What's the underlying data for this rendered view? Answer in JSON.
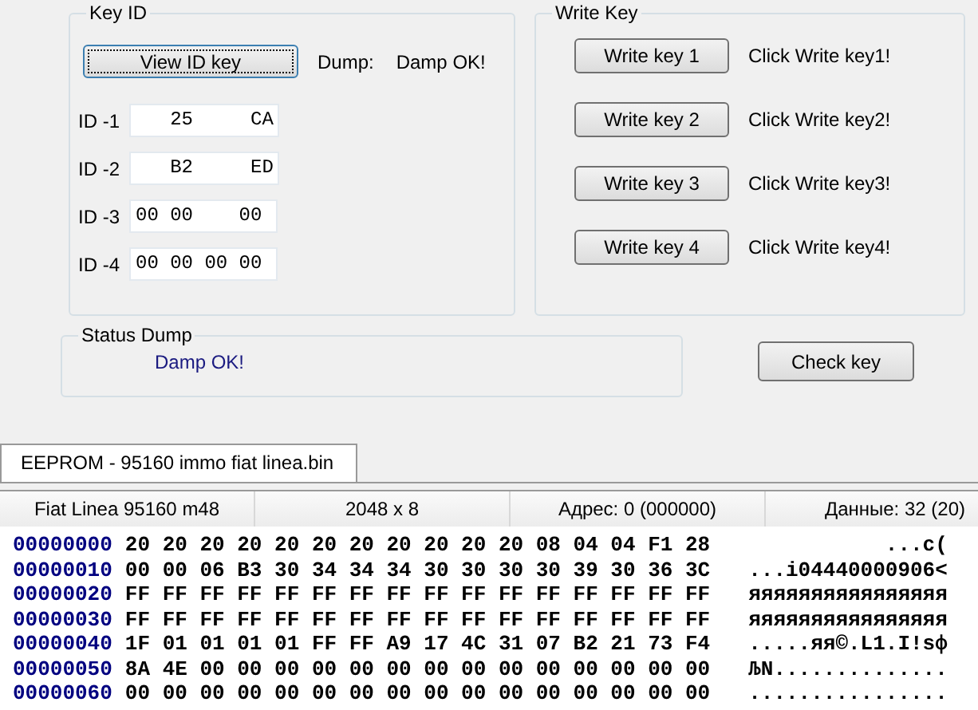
{
  "key_id": {
    "title": "Key ID",
    "view_button": {
      "label": "View ID key",
      "focused": true
    },
    "dump_label": "Dump:",
    "dump_value": "Damp OK!",
    "ids": [
      {
        "label": "ID -1",
        "value": "   25     CA"
      },
      {
        "label": "ID -2",
        "value": "   B2     ED"
      },
      {
        "label": "ID -3",
        "value": "00 00    00"
      },
      {
        "label": "ID -4",
        "value": "00 00 00 00"
      }
    ]
  },
  "write_key": {
    "title": "Write Key",
    "rows": [
      {
        "button": "Write key 1",
        "message": "Click Write key1!"
      },
      {
        "button": "Write key 2",
        "message": "Click Write key2!"
      },
      {
        "button": "Write key 3",
        "message": "Click Write key3!"
      },
      {
        "button": "Write key 4",
        "message": "Click Write key4!"
      }
    ]
  },
  "status_dump": {
    "title": "Status Dump",
    "message": "Damp OK!"
  },
  "check_button": "Check key",
  "tabs": [
    {
      "label": "EEPROM - 95160 immo fiat linea.bin",
      "selected": true
    }
  ],
  "status_bar": [
    "Fiat Linea 95160 m48",
    "2048 x 8",
    "Адрес: 0 (000000)",
    "Данные: 32 (20)"
  ],
  "hex_rows": [
    {
      "address": "00000000",
      "bytes": "20 20 20 20 20 20 20 20 20 20 20 08 04 04 F1 28",
      "ascii": "           ...c("
    },
    {
      "address": "00000010",
      "bytes": "00 00 06 B3 30 34 34 34 30 30 30 30 39 30 36 3C",
      "ascii": "...і04440000906<"
    },
    {
      "address": "00000020",
      "bytes": "FF FF FF FF FF FF FF FF FF FF FF FF FF FF FF FF",
      "ascii": "яяяяяяяяяяяяяяяя"
    },
    {
      "address": "00000030",
      "bytes": "FF FF FF FF FF FF FF FF FF FF FF FF FF FF FF FF",
      "ascii": "яяяяяяяяяяяяяяяя"
    },
    {
      "address": "00000040",
      "bytes": "1F 01 01 01 01 FF FF A9 17 4C 31 07 B2 21 73 F4",
      "ascii": ".....яя©.L1.І!sф"
    },
    {
      "address": "00000050",
      "bytes": "8A 4E 00 00 00 00 00 00 00 00 00 00 00 00 00 00",
      "ascii": "ЉN.............."
    },
    {
      "address": "00000060",
      "bytes": "00 00 00 00 00 00 00 00 00 00 00 00 00 00 00 00",
      "ascii": "................"
    }
  ]
}
